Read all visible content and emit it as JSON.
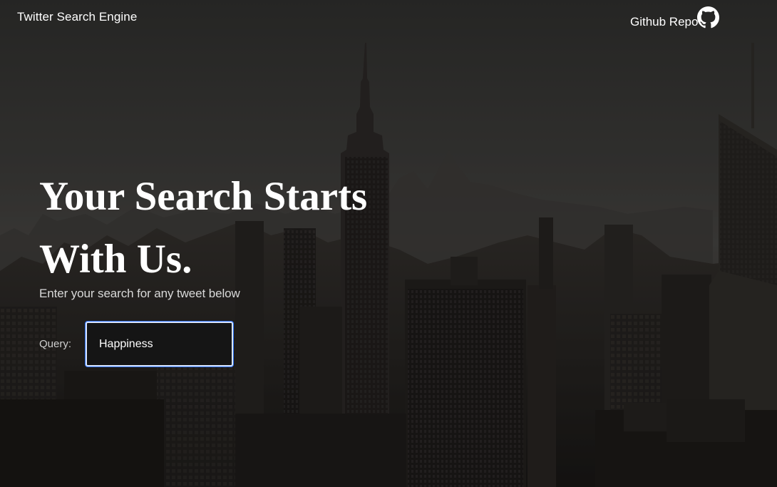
{
  "navbar": {
    "site_title": "Twitter Search Engine",
    "github_label": "Github Repo",
    "github_icon": "github-octocat-icon"
  },
  "hero": {
    "heading": "Your Search Starts With Us.",
    "subheading": "Enter your search for any tweet below"
  },
  "search": {
    "label": "Query:",
    "value": "Happiness",
    "placeholder": ""
  },
  "colors": {
    "text": "#ffffff",
    "overlay": "#000000",
    "input_background": "#151515",
    "focus_ring": "#2a6df0"
  }
}
